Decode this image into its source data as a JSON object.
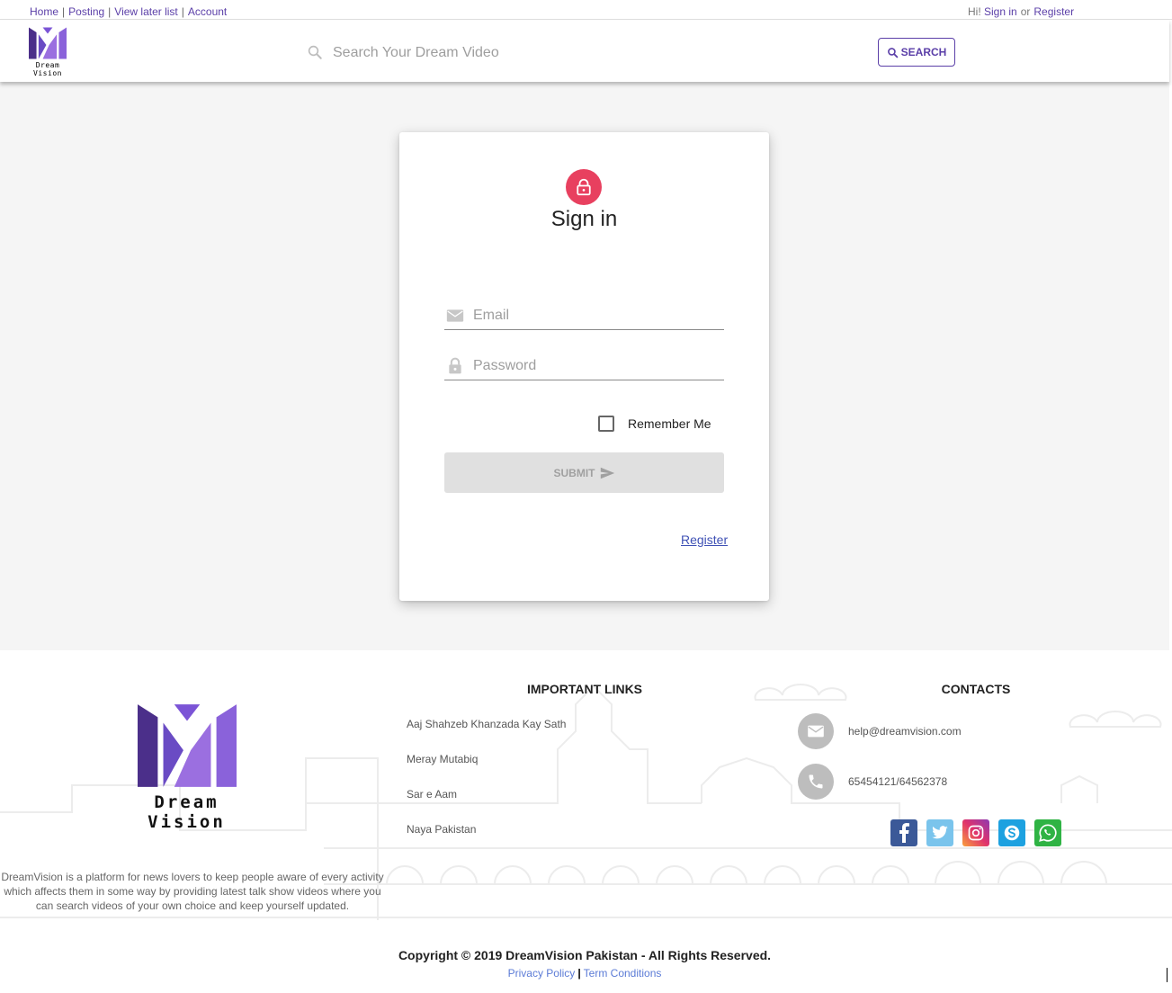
{
  "topnav": {
    "home": "Home",
    "posting": "Posting",
    "view_later": "View later list",
    "account": "Account",
    "separator": "|",
    "greeting": "Hi!",
    "signin": "Sign in",
    "or": "or",
    "register": "Register"
  },
  "header": {
    "logo_text": "Dream Vision",
    "search_placeholder": "Search Your Dream Video",
    "search_button": "SEARCH"
  },
  "signin_card": {
    "title": "Sign in",
    "email_placeholder": "Email",
    "password_placeholder": "Password",
    "remember_label": "Remember Me",
    "remember_checked": false,
    "submit_label": "SUBMIT",
    "register_link": "Register"
  },
  "footer": {
    "logo_text": "Dream Vision",
    "description": "DreamVision is a platform for news lovers to keep people aware of every activity which affects them in some way by providing latest talk show videos where you can search videos of your own choice and keep yourself updated.",
    "links_title": "IMPORTANT LINKS",
    "links": [
      "Aaj Shahzeb Khanzada Kay Sath",
      "Meray Mutabiq",
      "Sar e Aam",
      "Naya Pakistan"
    ],
    "contacts_title": "CONTACTS",
    "contact_email": "help@dreamvision.com",
    "contact_phone": "65454121/64562378",
    "socials": [
      "facebook-icon",
      "twitter-icon",
      "instagram-icon",
      "skype-icon",
      "whatsapp-icon"
    ]
  },
  "bottom": {
    "copyright": "Copyright © 2019 DreamVision Pakistan - All Rights Reserved.",
    "privacy": "Privacy Policy",
    "separator": "|",
    "terms": "Term Conditions"
  },
  "colors": {
    "brand_purple": "#5b3fa8",
    "logo_light_purple": "#9b6fe0",
    "lock_avatar": "#e8405f",
    "page_bg": "#f5f5f5",
    "link_blue": "#3f51b5"
  }
}
